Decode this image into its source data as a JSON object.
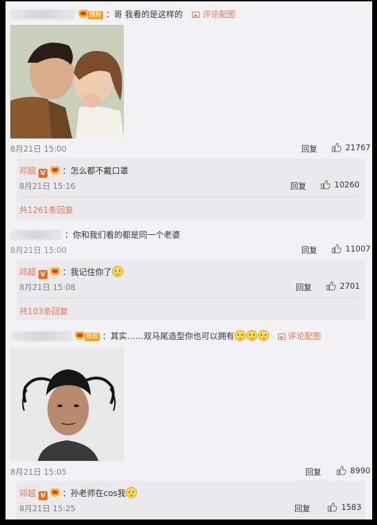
{
  "comments": [
    {
      "text": "：哥 我看的是这样的",
      "comment_pic_label": "评论配图",
      "fan_badge": "铁粉",
      "time": "8月21日 15:00",
      "reply_label": "回复",
      "likes": "21767",
      "reply": {
        "user": "邓超",
        "verified_mark": "V",
        "text": "：怎么都不戴口罩",
        "time": "8月21日 15:16",
        "reply_label": "回复",
        "likes": "10260"
      },
      "more_replies": "共1261条回复"
    },
    {
      "text": "：你和我们看的都是同一个老婆",
      "time": "8月21日 15:00",
      "reply_label": "回复",
      "likes": "11007",
      "reply": {
        "user": "邓超",
        "verified_mark": "V",
        "text": "：我记住你了",
        "time": "8月21日 15:08",
        "reply_label": "回复",
        "likes": "2701"
      },
      "more_replies": "共103条回复"
    },
    {
      "text": "：其实……双马尾造型你也可以拥有",
      "comment_pic_label": "评论配图",
      "fan_badge": "铁粉",
      "time": "8月21日 15:05",
      "reply_label": "回复",
      "likes": "8990",
      "reply": {
        "user": "邓超",
        "verified_mark": "V",
        "text": "：孙老师在cos我",
        "time": "8月21日 15:25",
        "reply_label": "回复",
        "likes": "1583"
      }
    }
  ],
  "colors": {
    "accent": "#eb7350",
    "meta": "#808080",
    "badge": "#f26b1a"
  },
  "icons": [
    "thumbs-up-icon",
    "picture-icon",
    "crown-badge-icon",
    "verified-icon",
    "emoji-icon"
  ]
}
